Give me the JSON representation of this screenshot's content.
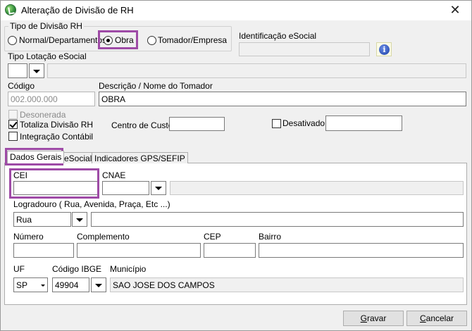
{
  "window": {
    "title": "Alteração de Divisão de RH"
  },
  "tipo_divisao": {
    "group_title": "Tipo de Divisão RH",
    "options": [
      {
        "label": "Normal/Departamentos",
        "checked": false
      },
      {
        "label": "Obra",
        "checked": true
      },
      {
        "label": "Tomador/Empresa",
        "checked": false
      }
    ]
  },
  "identificacao": {
    "label": "Identificação eSocial",
    "value": "",
    "info_icon": "info-icon"
  },
  "tipo_lotacao": {
    "label": "Tipo Lotação eSocial",
    "value": "",
    "description": ""
  },
  "codigo": {
    "label": "Código",
    "value": "002.000.000"
  },
  "descricao": {
    "label": "Descrição / Nome do Tomador",
    "value": "OBRA"
  },
  "checks": {
    "desonerada": {
      "label": "Desonerada",
      "checked": false,
      "disabled": true
    },
    "totaliza": {
      "label": "Totaliza Divisão RH",
      "checked": true
    },
    "integracao": {
      "label": "Integração Contábil",
      "checked": false
    },
    "desativado": {
      "label": "Desativado",
      "checked": false
    }
  },
  "centro_custo": {
    "label": "Centro de Custo",
    "value": ""
  },
  "desativado_field": {
    "value": ""
  },
  "tabs": [
    {
      "label": "Dados Gerais",
      "active": true
    },
    {
      "label": "eSocial",
      "active": false
    },
    {
      "label": "Indicadores GPS/SEFIP",
      "active": false
    }
  ],
  "dados_gerais": {
    "cei": {
      "label": "CEI",
      "value": ""
    },
    "cnae": {
      "label": "CNAE",
      "value": "",
      "description": ""
    },
    "logradouro": {
      "label": "Logradouro ( Rua, Avenida, Praça, Etc ...)",
      "tipo": "Rua",
      "value": ""
    },
    "numero": {
      "label": "Número",
      "value": ""
    },
    "complemento": {
      "label": "Complemento",
      "value": ""
    },
    "cep": {
      "label": "CEP",
      "value": ""
    },
    "bairro": {
      "label": "Bairro",
      "value": ""
    },
    "uf": {
      "label": "UF",
      "value": "SP"
    },
    "ibge": {
      "label": "Código IBGE",
      "value": "49904"
    },
    "municipio": {
      "label": "Município",
      "value": "SAO JOSE DOS CAMPOS"
    }
  },
  "buttons": {
    "gravar": {
      "pre": "",
      "accel": "G",
      "post": "ravar"
    },
    "cancelar": {
      "pre": "",
      "accel": "C",
      "post": "ancelar"
    }
  },
  "colors": {
    "highlight": "#9e4ba6",
    "window_bg": "#f0f0f0",
    "info_icon": "#1b3fa5"
  }
}
